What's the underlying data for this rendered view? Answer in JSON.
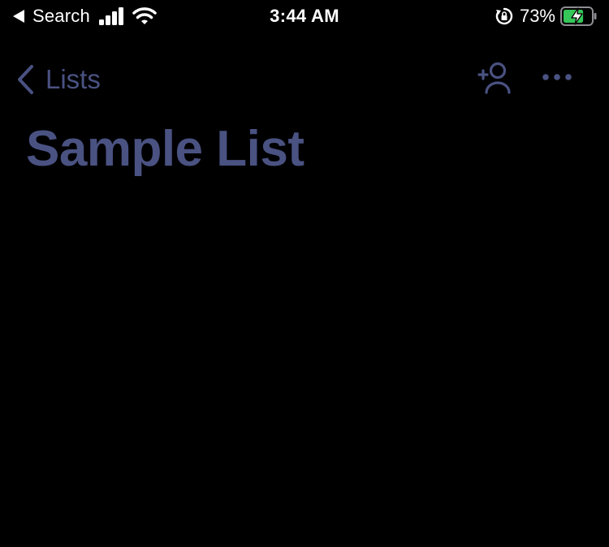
{
  "status_bar": {
    "back_app_label": "Search",
    "time": "3:44 AM",
    "battery_percent": "73%",
    "icons": {
      "back_arrow": "back-to-app-arrow-icon",
      "signal": "cellular-signal-icon",
      "wifi": "wifi-icon",
      "rotation_lock": "rotation-lock-icon",
      "battery": "battery-charging-icon"
    },
    "battery_level": 0.73,
    "battery_color": "#35c759"
  },
  "nav_bar": {
    "back_label": "Lists",
    "icons": {
      "back": "chevron-left-icon",
      "add_person": "add-person-icon",
      "more": "more-ellipsis-icon"
    }
  },
  "page": {
    "title": "Sample List"
  },
  "colors": {
    "background": "#000000",
    "accent": "#4a5282",
    "status_text": "#ffffff"
  }
}
